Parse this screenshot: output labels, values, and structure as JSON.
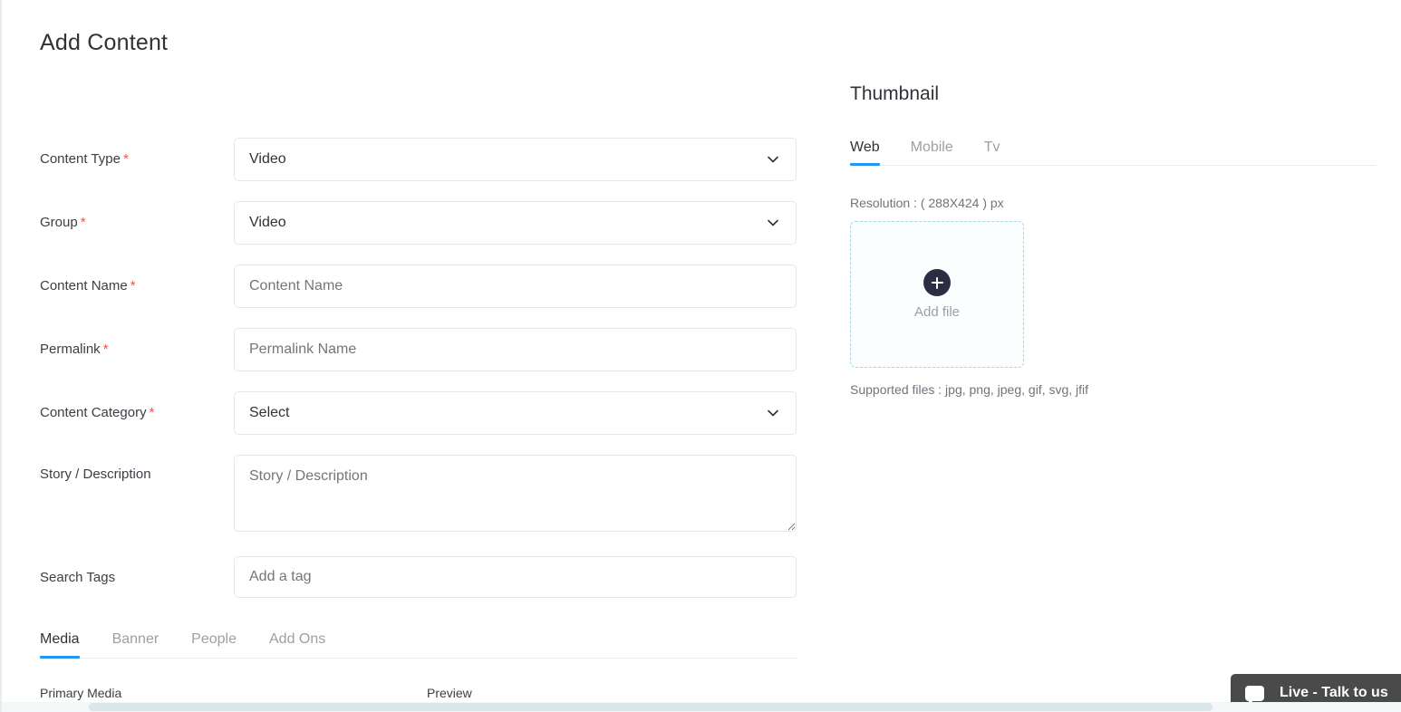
{
  "page": {
    "title": "Add Content"
  },
  "form": {
    "fields": [
      {
        "label": "Content Type",
        "required": true,
        "type": "select",
        "value": "Video",
        "placeholder": ""
      },
      {
        "label": "Group",
        "required": true,
        "type": "select",
        "value": "Video",
        "placeholder": ""
      },
      {
        "label": "Content Name",
        "required": true,
        "type": "text",
        "value": "",
        "placeholder": "Content Name"
      },
      {
        "label": "Permalink",
        "required": true,
        "type": "text",
        "value": "",
        "placeholder": "Permalink Name"
      },
      {
        "label": "Content Category",
        "required": true,
        "type": "select",
        "value": "Select",
        "placeholder": ""
      },
      {
        "label": "Story / Description",
        "required": false,
        "type": "textarea",
        "value": "",
        "placeholder": "Story / Description"
      },
      {
        "label": "Search Tags",
        "required": false,
        "type": "tag",
        "value": "",
        "placeholder": "Add a tag"
      }
    ],
    "required_marker": "*"
  },
  "bottom_tabs": {
    "items": [
      {
        "label": "Media",
        "active": true
      },
      {
        "label": "Banner",
        "active": false
      },
      {
        "label": "People",
        "active": false
      },
      {
        "label": "Add Ons",
        "active": false
      }
    ],
    "primary_media_label": "Primary Media",
    "preview_label": "Preview"
  },
  "thumbnail": {
    "title": "Thumbnail",
    "tabs": [
      {
        "label": "Web",
        "active": true
      },
      {
        "label": "Mobile",
        "active": false
      },
      {
        "label": "Tv",
        "active": false
      }
    ],
    "resolution": "Resolution : ( 288X424 ) px",
    "add_file_label": "Add file",
    "supported_files": "Supported files : jpg, png, jpeg, gif, svg, jfif"
  },
  "chat": {
    "label": "Live - Talk to us"
  },
  "colors": {
    "accent_blue": "#2196f3",
    "required_red": "#ef5350",
    "plus_dark": "#2b2d42",
    "dropzone_border": "#a8d4ee",
    "chat_background": "#4a4a4a",
    "text_primary": "#2e3338",
    "text_muted": "#9aa0a6"
  }
}
